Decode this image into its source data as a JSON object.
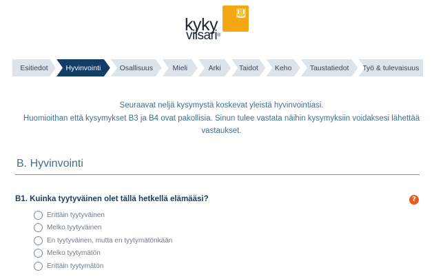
{
  "logo": {
    "line1": "kyky",
    "line2": "viisari",
    "mark": "®"
  },
  "steps": [
    {
      "label": "Esitiedot",
      "active": false
    },
    {
      "label": "Hyvinvointi",
      "active": true
    },
    {
      "label": "Osallisuus",
      "active": false
    },
    {
      "label": "Mieli",
      "active": false
    },
    {
      "label": "Arki",
      "active": false
    },
    {
      "label": "Taidot",
      "active": false
    },
    {
      "label": "Keho",
      "active": false
    },
    {
      "label": "Taustatiedot",
      "active": false
    },
    {
      "label": "Työ & tulevaisuus",
      "active": false
    }
  ],
  "intro": {
    "line1": "Seuraavat neljä kysymystä koskevat yleistä hyvinvointiasi.",
    "line2": "Huomioithan että kysymykset B3 ja B4 ovat pakollisia. Sinun tulee vastata näihin kysymyksiin voidaksesi lähettää",
    "line3": "vastaukset."
  },
  "section": {
    "title": "B. Hyvinvointi"
  },
  "question": {
    "text": "B1. Kuinka tyytyväinen olet tällä hetkellä elämääsi?",
    "help_icon": "?",
    "options": [
      "Erittäin tyytyväinen",
      "Melko tyytyväinen",
      "En tyytyväinen, mutta en tyytymätönkään",
      "Melko tyytymätön",
      "Erittäin tyytymätön"
    ]
  },
  "colors": {
    "active_step": "#123d67",
    "inactive_step": "#dde3ea",
    "help": "#e85c1f",
    "logo": "#f3a712"
  }
}
